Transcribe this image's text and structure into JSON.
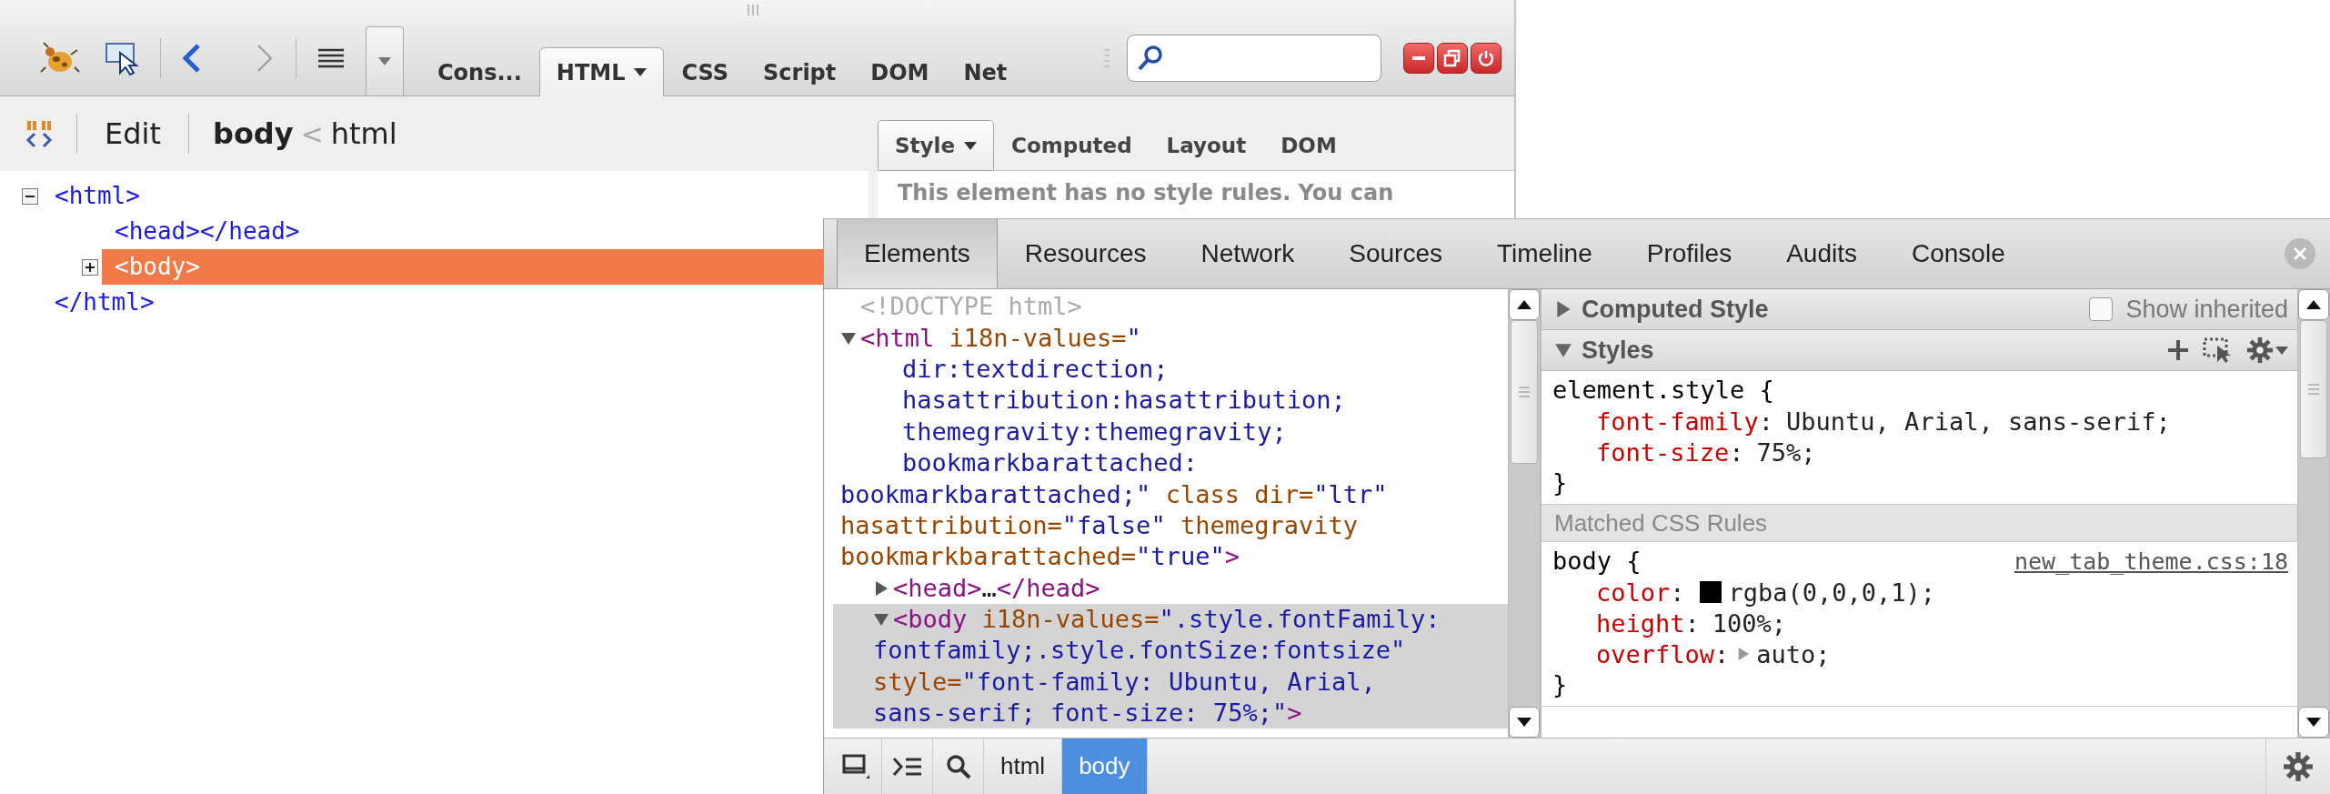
{
  "firebug": {
    "nav": [
      {
        "kind": "back",
        "disabled": false
      },
      {
        "kind": "forward",
        "disabled": true
      }
    ],
    "tabs": [
      {
        "label": "Cons...",
        "selected": false,
        "menu": false
      },
      {
        "label": "HTML",
        "selected": true,
        "menu": true
      },
      {
        "label": "CSS",
        "selected": false,
        "menu": false
      },
      {
        "label": "Script",
        "selected": false,
        "menu": false
      },
      {
        "label": "DOM",
        "selected": false,
        "menu": false
      },
      {
        "label": "Net",
        "selected": false,
        "menu": false
      }
    ],
    "window_controls": [
      {
        "kind": "minimize"
      },
      {
        "kind": "restore"
      },
      {
        "kind": "close"
      }
    ],
    "edit_button": "Edit",
    "breadcrumbs": [
      {
        "label": "body",
        "selected": true
      },
      {
        "label": "html",
        "selected": false
      }
    ],
    "breadcrumb_separator": "<",
    "side_tabs": [
      {
        "label": "Style",
        "selected": true,
        "menu": true
      },
      {
        "label": "Computed",
        "selected": false,
        "menu": false
      },
      {
        "label": "Layout",
        "selected": false,
        "menu": false
      },
      {
        "label": "DOM",
        "selected": false,
        "menu": false
      }
    ],
    "tree": [
      {
        "text": "<html>",
        "expandable": true,
        "expanded": true,
        "selected": false,
        "closing": "</html>",
        "children": [
          {
            "text": "<head></head>",
            "expandable": false,
            "selected": false
          },
          {
            "text": "<body>",
            "expandable": true,
            "expanded": false,
            "selected": true
          }
        ]
      }
    ],
    "style_message": "This element has no style rules. You can"
  },
  "devtools": {
    "tabs": [
      {
        "label": "Elements",
        "selected": true
      },
      {
        "label": "Resources",
        "selected": false
      },
      {
        "label": "Network",
        "selected": false
      },
      {
        "label": "Sources",
        "selected": false
      },
      {
        "label": "Timeline",
        "selected": false
      },
      {
        "label": "Profiles",
        "selected": false
      },
      {
        "label": "Audits",
        "selected": false
      },
      {
        "label": "Console",
        "selected": false
      }
    ],
    "elements": [
      {
        "expandable": false,
        "selected": false,
        "lines": [
          {
            "kind": "first",
            "segments": [
              {
                "kind": "doctype",
                "text": "<!DOCTYPE html>"
              }
            ]
          }
        ]
      },
      {
        "expandable": true,
        "expanded": true,
        "selected": false,
        "lines": [
          {
            "kind": "first",
            "segments": [
              {
                "kind": "tag",
                "text": "<html"
              },
              {
                "kind": "attr",
                "text": " i18n-values="
              },
              {
                "kind": "value",
                "text": "\""
              }
            ]
          },
          {
            "kind": "hang",
            "segments": [
              {
                "kind": "value",
                "text": "dir:textdirection;"
              }
            ]
          },
          {
            "kind": "hang",
            "segments": [
              {
                "kind": "value",
                "text": "hasattribution:hasattribution;"
              }
            ]
          },
          {
            "kind": "hang",
            "segments": [
              {
                "kind": "value",
                "text": "themegravity:themegravity;"
              }
            ]
          },
          {
            "kind": "hang",
            "segments": [
              {
                "kind": "value",
                "text": "bookmarkbarattached:"
              }
            ]
          },
          {
            "kind": "flush",
            "segments": [
              {
                "kind": "value",
                "text": "bookmarkbarattached;\""
              },
              {
                "kind": "attr",
                "text": " class dir="
              },
              {
                "kind": "value",
                "text": "\"ltr\""
              }
            ]
          },
          {
            "kind": "flush",
            "segments": [
              {
                "kind": "attr",
                "text": "hasattribution="
              },
              {
                "kind": "value",
                "text": "\"false\""
              },
              {
                "kind": "attr",
                "text": " themegravity"
              }
            ]
          },
          {
            "kind": "flush",
            "segments": [
              {
                "kind": "attr",
                "text": "bookmarkbarattached="
              },
              {
                "kind": "value",
                "text": "\"true\""
              },
              {
                "kind": "tag",
                "text": ">"
              }
            ]
          }
        ],
        "children": [
          {
            "expandable": true,
            "expanded": false,
            "selected": false,
            "lines": [
              {
                "kind": "first",
                "segments": [
                  {
                    "kind": "tag",
                    "text": "<head>"
                  },
                  {
                    "kind": "text",
                    "text": "…"
                  },
                  {
                    "kind": "tag",
                    "text": "</head>"
                  }
                ]
              }
            ]
          },
          {
            "expandable": true,
            "expanded": true,
            "selected": true,
            "lines": [
              {
                "kind": "first",
                "segments": [
                  {
                    "kind": "tag",
                    "text": "<body"
                  },
                  {
                    "kind": "attr",
                    "text": " i18n-values="
                  },
                  {
                    "kind": "value",
                    "text": "\".style.fontFamily:"
                  }
                ]
              },
              {
                "kind": "flush",
                "segments": [
                  {
                    "kind": "value",
                    "text": "fontfamily;.style.fontSize:fontsize\""
                  }
                ]
              },
              {
                "kind": "flush",
                "segments": [
                  {
                    "kind": "attr",
                    "text": "style="
                  },
                  {
                    "kind": "value",
                    "text": "\"font-family: Ubuntu, Arial,"
                  }
                ]
              },
              {
                "kind": "flush",
                "segments": [
                  {
                    "kind": "value",
                    "text": "sans-serif; font-size: 75%;\""
                  },
                  {
                    "kind": "tag",
                    "text": ">"
                  }
                ]
              }
            ]
          }
        ]
      }
    ],
    "styles": {
      "computed": {
        "title": "Computed Style",
        "expanded": false,
        "show_inherited": {
          "label": "Show inherited",
          "checked": false
        }
      },
      "styles_header": {
        "title": "Styles",
        "expanded": true
      },
      "element_style": {
        "selector": "element.style {",
        "properties": [
          {
            "name": "font-family",
            "colon": ":",
            "value": "Ubuntu, Arial, sans-serif;",
            "expander": false
          },
          {
            "name": "font-size",
            "colon": ":",
            "value": "75%;",
            "expander": false
          }
        ],
        "close": "}"
      },
      "matched_title": "Matched CSS Rules",
      "rules": [
        {
          "selector": "body {",
          "source": "new_tab_theme.css:18",
          "close": "}",
          "properties": [
            {
              "name": "color",
              "colon": ":",
              "value": "rgba(0,0,0,1);",
              "color": "#000000",
              "expander": false
            },
            {
              "name": "height",
              "colon": ":",
              "value": "100%;",
              "expander": false
            },
            {
              "name": "overflow",
              "colon": ":",
              "value": "auto;",
              "expander": true
            }
          ]
        }
      ]
    },
    "crumbs": [
      {
        "label": "html",
        "selected": false
      },
      {
        "label": "body",
        "selected": true
      }
    ]
  }
}
